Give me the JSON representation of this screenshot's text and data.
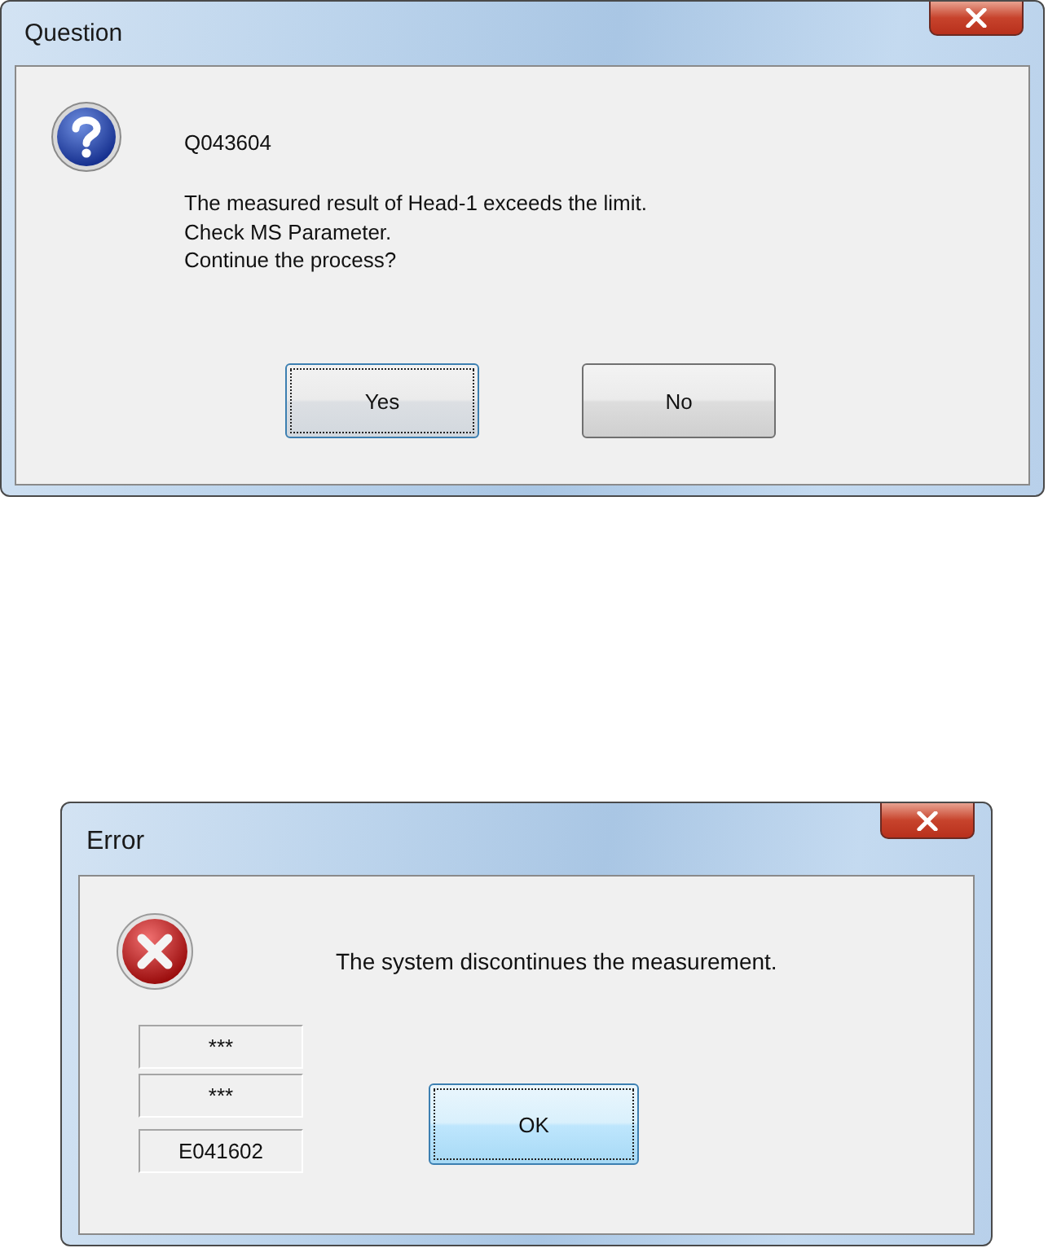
{
  "dialogs": [
    {
      "kind": "question",
      "title": "Question",
      "code": "Q043604",
      "message": "The measured result of Head-1 exceeds the limit.\nCheck MS Parameter.\nContinue the process?",
      "buttons": [
        {
          "label": "Yes",
          "focused": true
        },
        {
          "label": "No",
          "focused": false
        }
      ]
    },
    {
      "kind": "error",
      "title": "Error",
      "message": "The system discontinues the measurement.",
      "fields": [
        "***",
        "***",
        "E041602"
      ],
      "buttons": [
        {
          "label": "OK",
          "focused": true
        }
      ]
    }
  ]
}
